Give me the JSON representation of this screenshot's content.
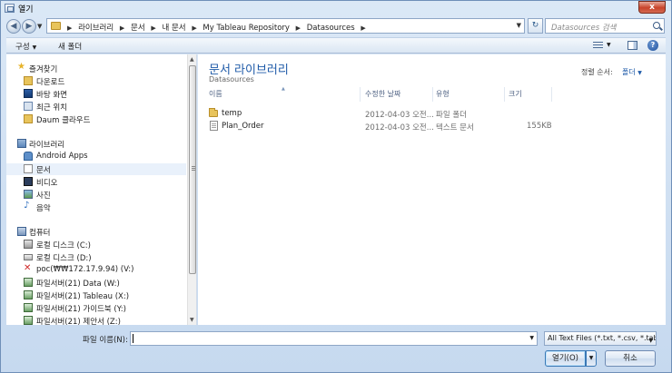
{
  "window": {
    "title": "열기",
    "close": "x"
  },
  "address": {
    "crumbs": [
      "라이브러리",
      "문서",
      "내 문서",
      "My Tableau Repository",
      "Datasources"
    ]
  },
  "search": {
    "placeholder": "Datasources 검색"
  },
  "toolbar": {
    "organize": "구성",
    "new_folder": "새 폴더"
  },
  "nav": {
    "favorites_header": "즐겨찾기",
    "favorites": [
      "다운로드",
      "바탕 화면",
      "최근 위치",
      "Daum 클라우드"
    ],
    "libraries_header": "라이브러리",
    "libraries": [
      "Android Apps",
      "문서",
      "비디오",
      "사진",
      "음악"
    ],
    "computer_header": "컴퓨터",
    "drives": [
      "로컬 디스크 (C:)",
      "로컬 디스크 (D:)",
      "poc(₩₩172.17.9.94) (V:)",
      "파일서버(21) Data (W:)",
      "파일서버(21) Tableau (X:)",
      "파일서버(21) 가이드북 (Y:)",
      "파일서버(21) 제안서 (Z:)"
    ]
  },
  "main": {
    "library_title": "문서 라이브러리",
    "library_sub": "Datasources",
    "arrange_label": "정렬 순서:",
    "arrange_value": "폴더",
    "columns": {
      "name": "이름",
      "modified": "수정한 날짜",
      "type": "유형",
      "size": "크기"
    },
    "files": [
      {
        "name": "temp",
        "modified": "2012-04-03 오전...",
        "type": "파일 폴더",
        "size": "",
        "kind": "folder"
      },
      {
        "name": "Plan_Order",
        "modified": "2012-04-03 오전...",
        "type": "텍스트 문서",
        "size": "155KB",
        "kind": "document"
      }
    ]
  },
  "bottom": {
    "filename_label": "파일 이름(N):",
    "filename_value": "",
    "filter": "All Text Files (*.txt, *.csv, *.tab)",
    "open_label": "열기(O)",
    "cancel_label": "취소"
  },
  "colors": {
    "accent": "#1e5aa8",
    "folder": "#e8c45c"
  }
}
